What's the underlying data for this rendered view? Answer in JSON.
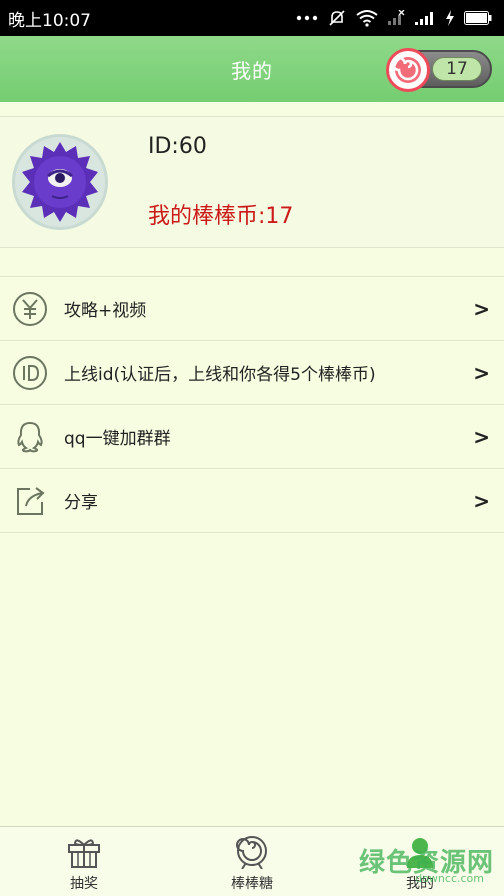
{
  "status_bar": {
    "time": "晚上10:07"
  },
  "header": {
    "title": "我的",
    "coin_count": "17"
  },
  "profile": {
    "user_id": "ID:60",
    "coin_text": "我的棒棒币:17"
  },
  "menu": [
    {
      "label": "攻略+视频",
      "icon": "yuan-coin-icon",
      "arrow": ">"
    },
    {
      "label": "上线id(认证后，上线和你各得5个棒棒币)",
      "icon": "id-badge-icon",
      "arrow": ">"
    },
    {
      "label": "qq一键加群群",
      "icon": "qq-icon",
      "arrow": ">"
    },
    {
      "label": "分享",
      "icon": "share-icon",
      "arrow": ">"
    }
  ],
  "bottom_nav": [
    {
      "label": "抽奖",
      "icon": "gift-icon"
    },
    {
      "label": "棒棒糖",
      "icon": "lollipop-icon"
    },
    {
      "label": "我的",
      "icon": "profile-icon",
      "active": true
    }
  ],
  "watermark": {
    "text": "绿色资源网",
    "sub": "downcc.com"
  },
  "colors": {
    "header": "#7ed27a",
    "background": "#f6fde0",
    "coin_text": "#cc1a1a"
  }
}
